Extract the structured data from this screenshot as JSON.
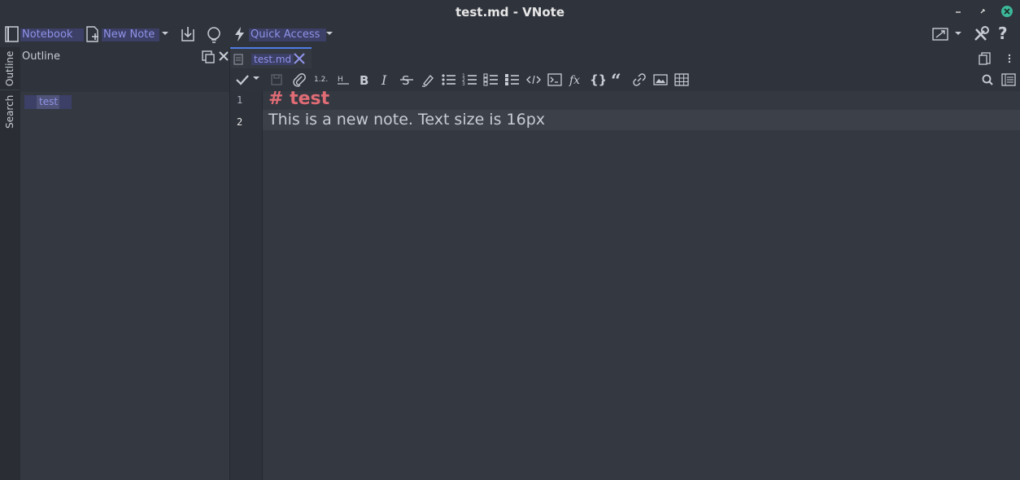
{
  "window": {
    "title": "test.md - VNote"
  },
  "toolbar": {
    "notebook_label": "Notebook",
    "new_note_label": "New Note",
    "quick_access_label": "Quick Access"
  },
  "sidebar": {
    "tabs": [
      {
        "label": "Outline"
      },
      {
        "label": "Search"
      }
    ]
  },
  "outline": {
    "title": "Outline",
    "items": [
      {
        "label": "test"
      }
    ]
  },
  "editor": {
    "tab_label": "test.md",
    "line_numbers": [
      "1",
      "2"
    ],
    "lines": [
      "# test",
      "This is a new note. Text size is 16px"
    ]
  },
  "colors": {
    "accent": "#8f93e8",
    "heading": "#e06c75",
    "background": "#2e323a"
  }
}
